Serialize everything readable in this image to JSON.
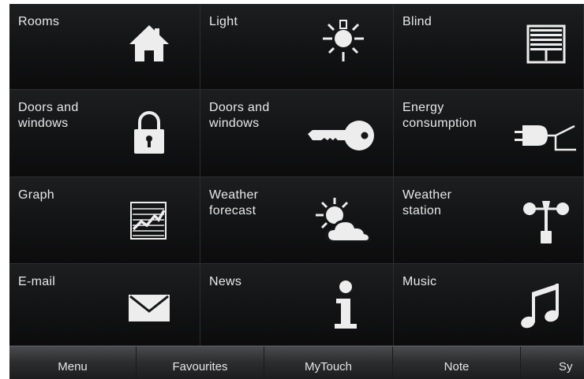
{
  "tiles": [
    {
      "label": "Rooms",
      "icon": "house-icon"
    },
    {
      "label": "Light",
      "icon": "light-bulb-icon"
    },
    {
      "label": "Blind",
      "icon": "blind-icon"
    },
    {
      "label": "Doors and\nwindows",
      "icon": "padlock-icon"
    },
    {
      "label": "Doors and\nwindows",
      "icon": "key-icon"
    },
    {
      "label": "Energy\nconsumption",
      "icon": "power-plug-icon"
    },
    {
      "label": "Graph",
      "icon": "graph-icon"
    },
    {
      "label": "Weather\nforecast",
      "icon": "sun-cloud-icon"
    },
    {
      "label": "Weather\nstation",
      "icon": "anemometer-icon"
    },
    {
      "label": "E-mail",
      "icon": "envelope-icon"
    },
    {
      "label": "News",
      "icon": "info-icon"
    },
    {
      "label": "Music",
      "icon": "music-note-icon"
    }
  ],
  "bottom_bar": {
    "items": [
      "Menu",
      "Favourites",
      "MyTouch",
      "Note",
      "Sy"
    ]
  },
  "colors": {
    "tile_background": "#151617",
    "icon": "#ededed",
    "text": "#e9e9e9",
    "bar": "#2d2e30"
  }
}
